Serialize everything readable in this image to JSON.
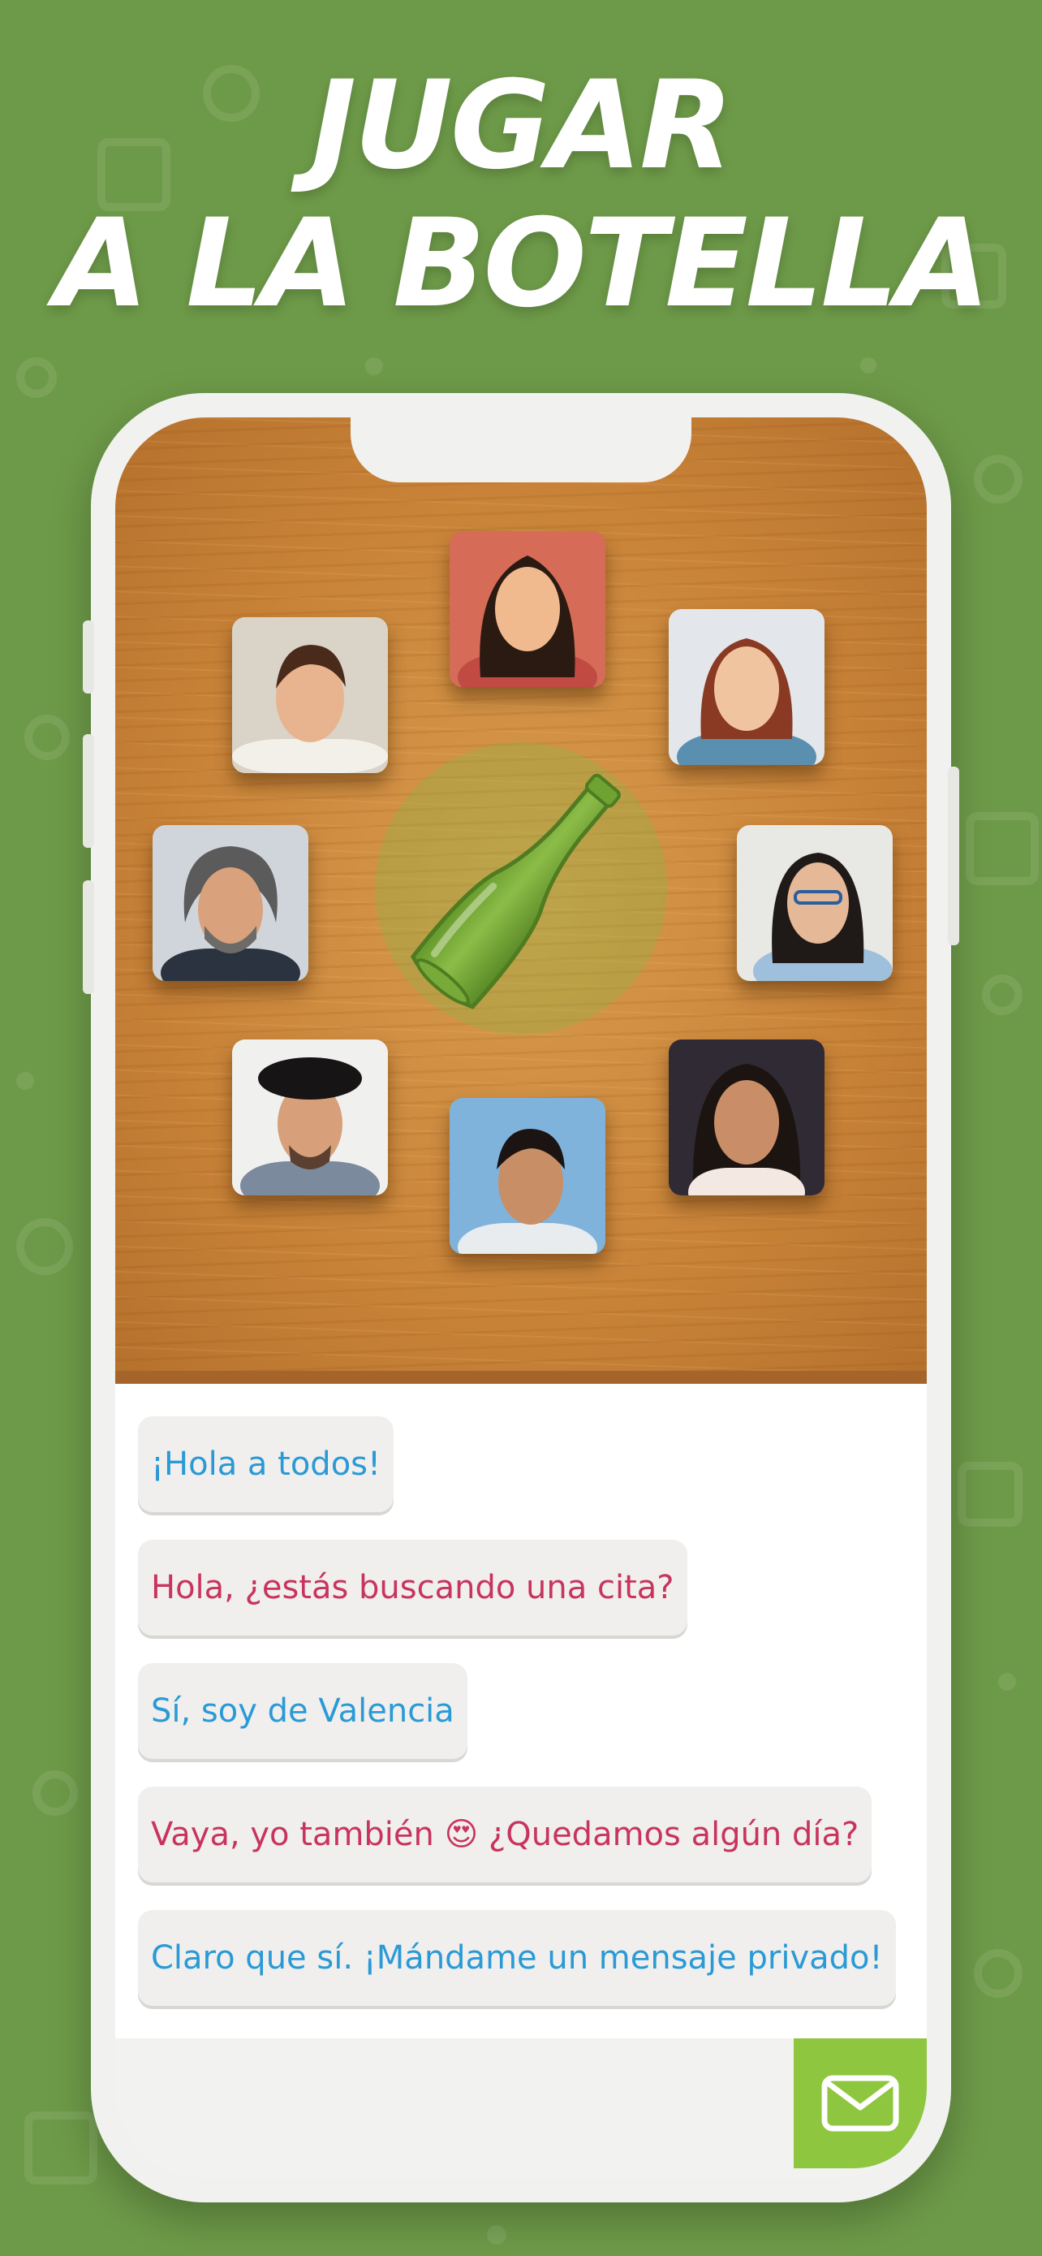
{
  "headline": {
    "line1": "JUGAR",
    "line2": "A LA BOTELLA"
  },
  "colors": {
    "background": "#6d9a48",
    "wood": "#c98338",
    "blue_text": "#2a9ad6",
    "pink_text": "#c8345e",
    "send_button": "#8ec63f"
  },
  "game": {
    "center_icon": "bottle-icon",
    "players": [
      {
        "name": "player-1",
        "skin": "#e8b48f",
        "hair": "#4a2a1a",
        "shirt": "#f3f0ea",
        "bg": "#d9d3c8"
      },
      {
        "name": "player-2",
        "skin": "#f0b98e",
        "hair": "#2b1a12",
        "shirt": "#c14a43",
        "bg": "#d66c58"
      },
      {
        "name": "player-3",
        "skin": "#f1c4a0",
        "hair": "#8a3a22",
        "shirt": "#5a8fb0",
        "bg": "#e3e6ea"
      },
      {
        "name": "player-4",
        "skin": "#d9a27c",
        "hair": "#5b5b5b",
        "shirt": "#2c3340",
        "bg": "#cfd5da"
      },
      {
        "name": "player-5",
        "skin": "#e5b897",
        "hair": "#1f1a18",
        "shirt": "#9ec0dc",
        "bg": "#e8e8e5"
      },
      {
        "name": "player-6",
        "skin": "#d7a07a",
        "hair": "#161414",
        "shirt": "#7b8a9c",
        "bg": "#f0f0ee"
      },
      {
        "name": "player-7",
        "skin": "#c88f66",
        "hair": "#1b1412",
        "shirt": "#e9ecef",
        "bg": "#7fb3dc"
      },
      {
        "name": "player-8",
        "skin": "#c98e68",
        "hair": "#1c1410",
        "shirt": "#f4e9e2",
        "bg": "#2f2a33"
      }
    ]
  },
  "chat": {
    "messages": [
      {
        "text": "¡Hola a todos!",
        "color": "blue"
      },
      {
        "text": "Hola, ¿estás buscando una cita?",
        "color": "pink"
      },
      {
        "text": "Sí, soy de Valencia",
        "color": "blue"
      },
      {
        "text": "Vaya, yo también 😍 ¿Quedamos algún día?",
        "color": "pink"
      },
      {
        "text": "Claro que sí. ¡Mándame un mensaje privado!",
        "color": "blue"
      }
    ],
    "send_icon": "mail-icon"
  }
}
